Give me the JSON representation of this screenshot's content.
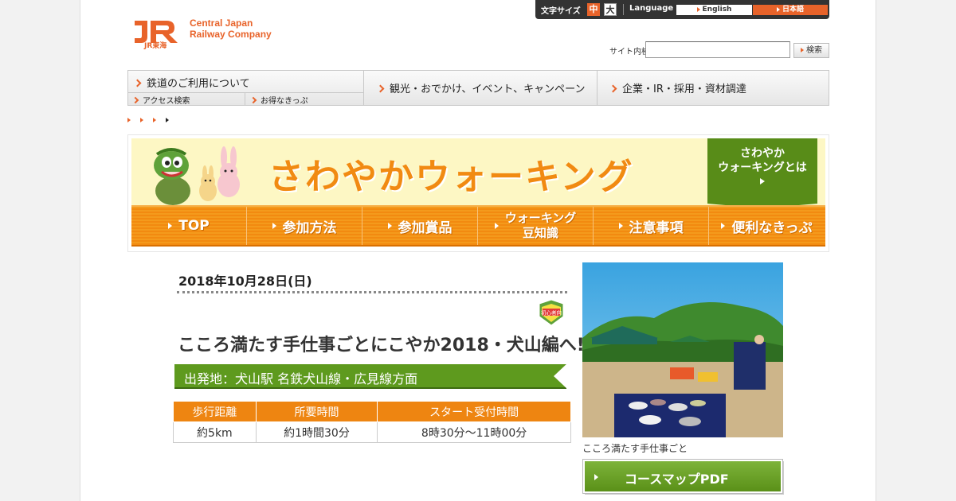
{
  "header": {
    "company_line1": "Central Japan",
    "company_line2": "Railway Company",
    "logo_sub": "JR東海",
    "font_size_label": "文字サイズ",
    "font_size_mid": "中",
    "font_size_large": "大",
    "language_label": "Language",
    "lang_english": "English",
    "lang_japanese": "日本語",
    "search_label": "サイト内検索",
    "search_value": "",
    "search_button": "検索"
  },
  "nav": {
    "rail": "鉄道のご利用について",
    "rail_sub1": "アクセス検索",
    "rail_sub2": "お得なきっぷ",
    "tour": "観光・おでかけ、イベント、キャンペーン",
    "corp": "企業・IR・採用・資材調達"
  },
  "banner": {
    "title": "さわやかウォーキング",
    "about_line1": "さわやか",
    "about_line2": "ウォーキングとは",
    "tabs": [
      {
        "label": "TOP"
      },
      {
        "label": "参加方法"
      },
      {
        "label": "参加賞品"
      },
      {
        "label1": "ウォーキング",
        "label2": "豆知識"
      },
      {
        "label": "注意事項"
      },
      {
        "label": "便利なきっぷ"
      }
    ]
  },
  "event": {
    "date": "2018年10月28日(日)",
    "beginner_badge": "初心者向",
    "title": "こころ満たす手仕事ごとにこやか2018・犬山編へ!",
    "course_bar": "出発地：犬山駅 名鉄犬山線・広見線方面",
    "table_headers": [
      "歩行距離",
      "所要時間",
      "スタート受付時間"
    ],
    "table_row": [
      "約5km",
      "約1時間30分",
      "8時30分～11時00分"
    ],
    "photo_caption": "こころ満たす手仕事ごと",
    "pdf_button": "コースマップPDF"
  },
  "colors": {
    "brand_orange": "#e8632a",
    "tab_orange": "#f28a10",
    "green": "#5e9a1e"
  }
}
